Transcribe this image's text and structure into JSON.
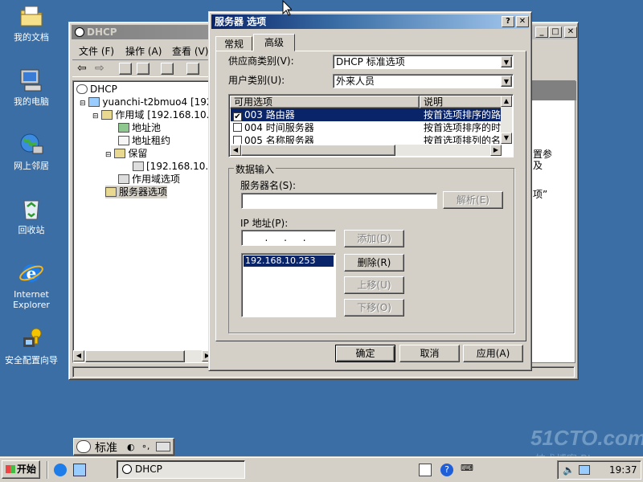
{
  "desktop": {
    "icons": [
      {
        "label": "我的文档",
        "icon": "folder-documents-icon"
      },
      {
        "label": "我的电脑",
        "icon": "computer-icon"
      },
      {
        "label": "网上邻居",
        "icon": "network-icon"
      },
      {
        "label": "回收站",
        "icon": "recycle-bin-icon"
      },
      {
        "label_line1": "Internet",
        "label_line2": "Explorer",
        "icon": "ie-icon"
      },
      {
        "label": "安全配置向导",
        "icon": "security-wizard-icon"
      }
    ],
    "background": "#3a6ea5"
  },
  "dhcp_window": {
    "title": "DHCP",
    "menu": [
      "文件 (F)",
      "操作 (A)",
      "查看 (V)"
    ],
    "tree": [
      {
        "label": "DHCP"
      },
      {
        "label": "yuanchi-t2bmuo4 [192."
      },
      {
        "label": "作用域 [192.168.10."
      },
      {
        "label": "地址池"
      },
      {
        "label": "地址租约"
      },
      {
        "label": "保留"
      },
      {
        "label": "[192.168.10."
      },
      {
        "label": "作用域选项"
      },
      {
        "label": "服务器选项"
      }
    ],
    "right_text": [
      "置参",
      "及",
      "项”"
    ]
  },
  "dialog": {
    "title": "服务器 选项",
    "help": "?",
    "close": "✕",
    "tabs": [
      {
        "label": "常规"
      },
      {
        "label": "高级"
      }
    ],
    "vendor_label": "供应商类别(V):",
    "vendor_value": "DHCP 标准选项",
    "user_label": "用户类别(U):",
    "user_value": "外来人员",
    "options_table": {
      "headers": [
        "可用选项",
        "说明"
      ],
      "rows": [
        {
          "checked": true,
          "option": "003 路由器",
          "desc": "按首选项排序的路"
        },
        {
          "checked": false,
          "option": "004 时间服务器",
          "desc": "按首选项排序的时"
        },
        {
          "checked": false,
          "option": "005 名称服务器",
          "desc": "按首选项排列的名"
        }
      ]
    },
    "data_entry": {
      "group_label": "数据输入",
      "server_name_label": "服务器名(S):",
      "server_name_value": "",
      "resolve_button": "解析(E)",
      "ip_label": "IP 地址(P):",
      "ip_value": ".  .  .",
      "add_button": "添加(D)",
      "ip_list": [
        "192.168.10.253"
      ],
      "remove_button": "删除(R)",
      "up_button": "上移(U)",
      "down_button": "下移(O)"
    },
    "ok_button": "确定",
    "cancel_button": "取消",
    "apply_button": "应用(A)"
  },
  "ime_bar": {
    "label": "标准"
  },
  "taskbar": {
    "start_label": "开始",
    "task_button": "DHCP",
    "clock": "19:37"
  },
  "watermark": {
    "main": "51CTO.com",
    "sub": "技术博客 Blog"
  }
}
